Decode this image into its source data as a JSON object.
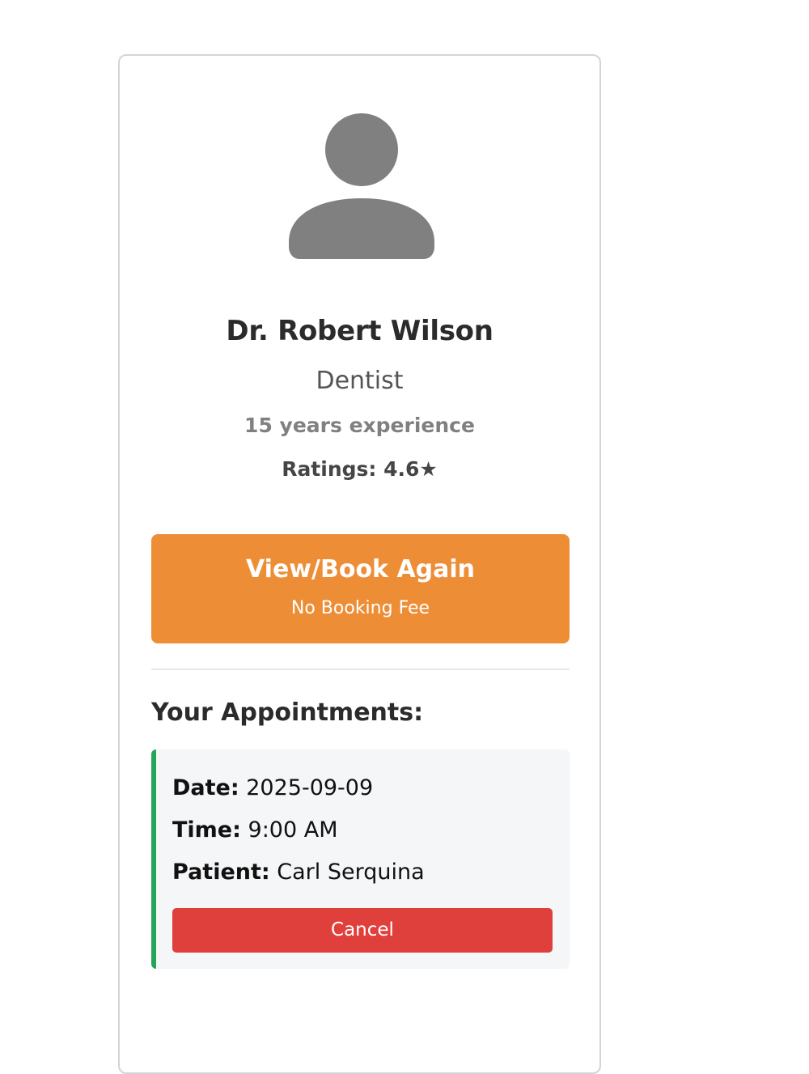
{
  "doctor": {
    "name": "Dr. Robert Wilson",
    "specialty": "Dentist",
    "experience": "15 years experience",
    "rating_text": "Ratings: 4.6★",
    "avatar_icon": "person-silhouette-icon",
    "avatar_color": "#808080"
  },
  "booking_button": {
    "label": "View/Book Again",
    "sublabel": "No Booking Fee",
    "color": "#ed8e37"
  },
  "appointments": {
    "heading": "Your Appointments:",
    "accent_color": "#27a35a",
    "items": [
      {
        "date_label": "Date:",
        "date_value": "2025-09-09",
        "time_label": "Time:",
        "time_value": "9:00 AM",
        "patient_label": "Patient:",
        "patient_value": "Carl Serquina",
        "cancel_label": "Cancel",
        "cancel_color": "#e0403c"
      }
    ]
  }
}
